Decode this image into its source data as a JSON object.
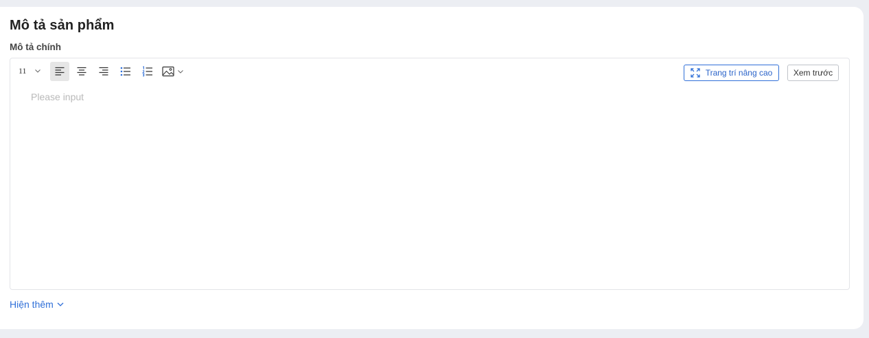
{
  "section": {
    "title": "Mô tả sản phẩm",
    "field_label": "Mô tả chính"
  },
  "toolbar": {
    "font_size": "11",
    "icons": [
      "chevron-down-icon",
      "align-left-icon",
      "align-center-icon",
      "align-right-icon",
      "bulleted-list-icon",
      "numbered-list-icon",
      "image-icon"
    ],
    "active_tool": "align-left",
    "advanced_label": "Trang trí nâng cao",
    "preview_label": "Xem trước"
  },
  "editor": {
    "placeholder": "Please input",
    "value": ""
  },
  "footer": {
    "show_more_label": "Hiện thêm"
  },
  "colors": {
    "accent": "#2f6fd8",
    "page_bg": "#eceef3",
    "card_bg": "#ffffff",
    "border": "#e3e4e8",
    "active_bg": "#e6e6e6"
  }
}
